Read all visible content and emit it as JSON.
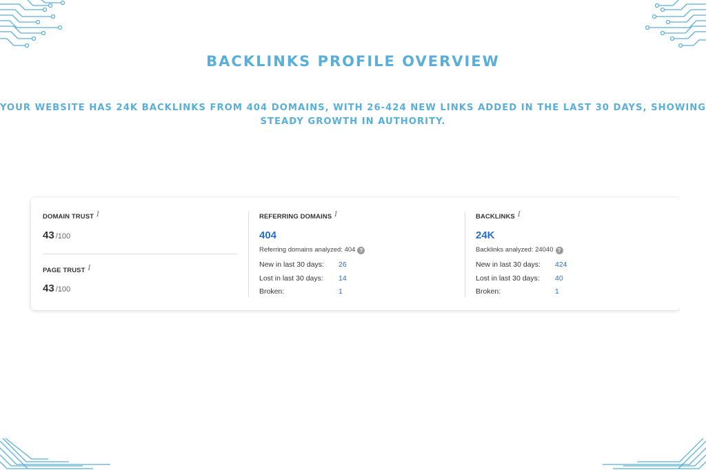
{
  "header": {
    "title": "BACKLINKS PROFILE OVERVIEW",
    "subtitle": "YOUR WEBSITE HAS 24K BACKLINKS FROM 404 DOMAINS, WITH 26-424 NEW LINKS ADDED IN THE LAST 30 DAYS, SHOWING STEADY GROWTH IN AUTHORITY."
  },
  "colors": {
    "accent": "#5aafd9",
    "value_blue": "#2a6fc7",
    "text": "#333333"
  },
  "trust": {
    "domain_label": "DOMAIN TRUST",
    "domain_value": "43",
    "domain_of": "/100",
    "page_label": "PAGE TRUST",
    "page_value": "43",
    "page_of": "/100"
  },
  "referring_domains": {
    "label": "REFERRING DOMAINS",
    "value": "404",
    "analyzed": "Referring domains analyzed: 404",
    "rows": [
      {
        "label": "New in last 30 days:",
        "value": "26"
      },
      {
        "label": "Lost in last 30 days:",
        "value": "14"
      },
      {
        "label": "Broken:",
        "value": "1"
      }
    ]
  },
  "backlinks": {
    "label": "BACKLINKS",
    "value": "24K",
    "analyzed": "Backlinks analyzed: 24040",
    "rows": [
      {
        "label": "New in last 30 days:",
        "value": "424"
      },
      {
        "label": "Lost in last 30 days:",
        "value": "40"
      },
      {
        "label": "Broken:",
        "value": "1"
      }
    ]
  },
  "icons": {
    "info": "i",
    "help": "?"
  }
}
